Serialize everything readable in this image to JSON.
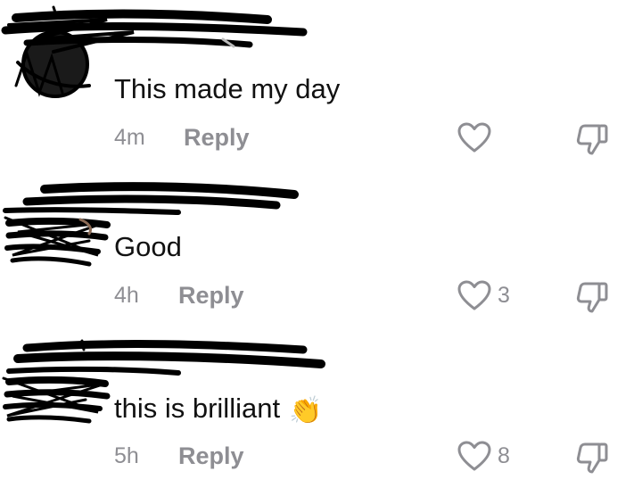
{
  "comments": [
    {
      "text": "This made my day",
      "emoji": "",
      "time": "4m",
      "reply_label": "Reply",
      "like_count": ""
    },
    {
      "text": "Good",
      "emoji": "",
      "time": "4h",
      "reply_label": "Reply",
      "like_count": "3"
    },
    {
      "text": "this is brilliant",
      "emoji": "👏",
      "time": "5h",
      "reply_label": "Reply",
      "like_count": "8"
    }
  ],
  "colors": {
    "text": "#111111",
    "muted": "#8e8e93",
    "redaction": "#000000"
  },
  "icons": {
    "like": "heart-outline-icon",
    "dislike": "thumbs-down-outline-icon"
  }
}
